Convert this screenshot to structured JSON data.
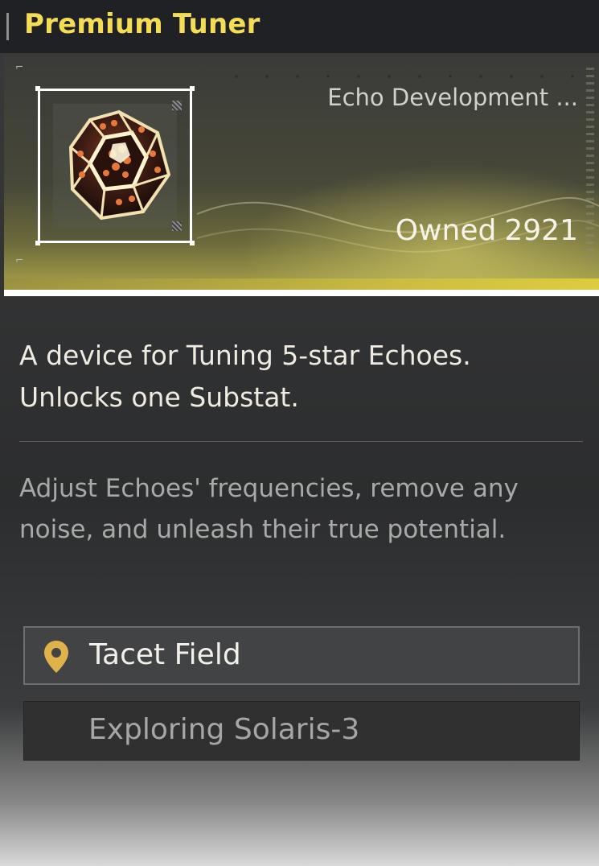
{
  "header": {
    "title": "Premium Tuner"
  },
  "item": {
    "category": "Echo Development ...",
    "owned_label": "Owned",
    "owned_count": "2921",
    "icon": "tuner-dice-icon"
  },
  "description": {
    "main": "A device for Tuning 5-star Echoes. Unlocks one Substat.",
    "lore": "Adjust Echoes' frequencies, remove any noise, and unleash their true potential."
  },
  "sources": [
    {
      "label": "Tacet Field",
      "icon": "location-pin-icon"
    },
    {
      "label": "Exploring Solaris-3"
    }
  ],
  "colors": {
    "title": "#f5dc55",
    "pin": "#e0b24a",
    "accent_glow": "#e6d23c"
  }
}
